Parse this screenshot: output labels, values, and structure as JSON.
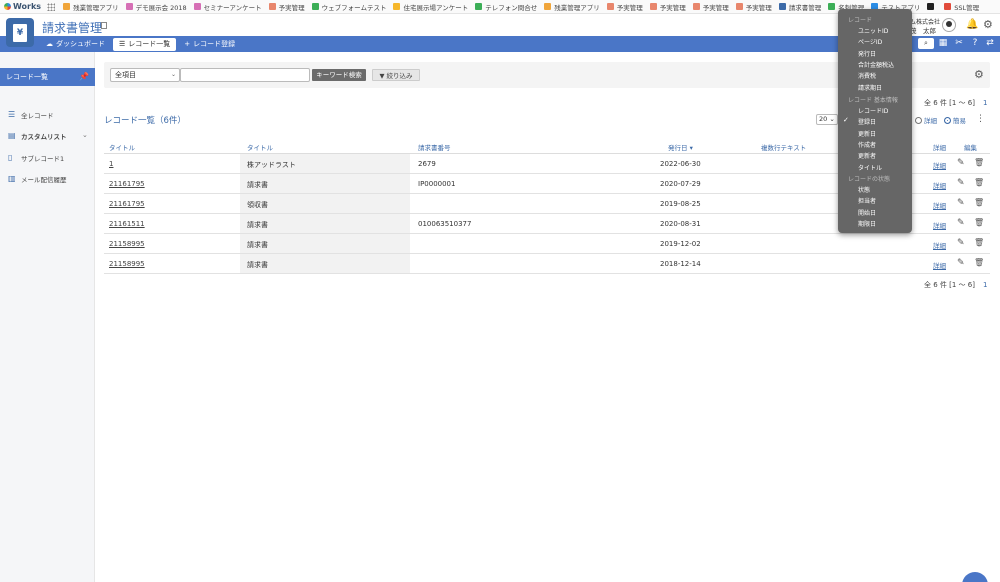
{
  "bookmarks": {
    "brand": "Works",
    "items": [
      {
        "label": "残業管理アプリ",
        "color": "#f0a53a"
      },
      {
        "label": "デモ展示会 2018",
        "color": "#d66fb5"
      },
      {
        "label": "セミナーアンケート",
        "color": "#d66fb5"
      },
      {
        "label": "予実管理",
        "color": "#e8866c"
      },
      {
        "label": "ウェブフォームテスト",
        "color": "#3cae57"
      },
      {
        "label": "住宅展示場アンケート",
        "color": "#f6b72b"
      },
      {
        "label": "テレフォン問合せ",
        "color": "#3cae57"
      },
      {
        "label": "残業管理アプリ",
        "color": "#f0a53a"
      },
      {
        "label": "予実管理",
        "color": "#e8866c"
      },
      {
        "label": "予実管理",
        "color": "#e8866c"
      },
      {
        "label": "予実管理",
        "color": "#e8866c"
      },
      {
        "label": "予実管理",
        "color": "#e8866c"
      },
      {
        "label": "請求書管理",
        "color": "#3c6aa8"
      },
      {
        "label": "名刺管理",
        "color": "#3cae57"
      },
      {
        "label": "テストアプリ",
        "color": "#2b8de6"
      },
      {
        "label": "",
        "color": "#222222"
      },
      {
        "label": "SSL管理",
        "color": "#e14b3b"
      }
    ]
  },
  "header": {
    "app_title": "請求書管理",
    "org_name": "ム株式会社",
    "user_name": "茂　太郎"
  },
  "nav": {
    "dashboard": "ダッシュボード",
    "record_list": "レコード一覧",
    "record_register": "レコード登録"
  },
  "sidebar": {
    "head": "レコード一覧",
    "items": [
      "全レコード",
      "カスタムリスト",
      "サブレコード1",
      "メール配信履歴"
    ]
  },
  "filter": {
    "select_value": "全項目",
    "keyword_button": "キーワード検索",
    "narrow_button": "絞り込み"
  },
  "list": {
    "title": "レコード一覧（6件）",
    "pager": "全 6 件 [1 ～ 6]",
    "pager_page": "1",
    "per_page": "20",
    "view_detail": "詳細",
    "view_simple": "簡易",
    "columns": [
      "タイトル",
      "タイトル",
      "請求書番号",
      "発行日",
      "複数行テキスト",
      "詳細",
      "編集"
    ],
    "rows": [
      {
        "id": "1",
        "title": "株アッドラスト",
        "number": "2679",
        "date": "2022-06-30",
        "detail": "詳細"
      },
      {
        "id": "21161795",
        "title": "請求書",
        "number": "IP0000001",
        "date": "2020-07-29",
        "detail": "詳細"
      },
      {
        "id": "21161795",
        "title": "領収書",
        "number": "",
        "date": "2019-08-25",
        "detail": "詳細"
      },
      {
        "id": "21161511",
        "title": "請求書",
        "number": "010063510377",
        "date": "2020-08-31",
        "detail": "詳細"
      },
      {
        "id": "21158995",
        "title": "請求書",
        "number": "",
        "date": "2019-12-02",
        "detail": "詳細"
      },
      {
        "id": "21158995",
        "title": "請求書",
        "number": "",
        "date": "2018-12-14",
        "detail": "詳細"
      }
    ]
  },
  "dropdown": {
    "group1": "レコード",
    "items1": [
      "ユニットID",
      "ページID",
      "発行日",
      "合計金額税込",
      "消費税",
      "請求期日"
    ],
    "group2": "レコード 基本情報",
    "items2": [
      "レコードID",
      "登録日",
      "更新日",
      "作成者",
      "更新者",
      "タイトル"
    ],
    "checked": "登録日",
    "group3": "レコードの状態",
    "items3": [
      "状態",
      "担当者",
      "開始日",
      "期限日"
    ]
  }
}
